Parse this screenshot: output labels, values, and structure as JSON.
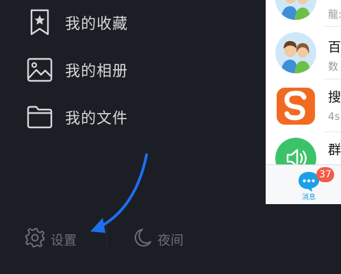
{
  "menu": {
    "items": [
      {
        "label": "我的收藏",
        "icon": "bookmark-star-icon"
      },
      {
        "label": "我的相册",
        "icon": "photo-album-icon"
      },
      {
        "label": "我的文件",
        "icon": "folder-icon"
      }
    ]
  },
  "bottom": {
    "settings_label": "设置",
    "settings_icon": "gear-icon",
    "night_label": "夜间",
    "night_icon": "moon-icon"
  },
  "annotation": {
    "arrow_color": "#1e6ff0",
    "arrow_icon": "curved-arrow-icon"
  },
  "chat_list": {
    "rows": [
      {
        "title": "",
        "subtitle": "龍:",
        "avatar": "couple-avatar-icon"
      },
      {
        "title": "百",
        "subtitle": "数",
        "avatar": "couple-avatar-icon"
      },
      {
        "title": "搜",
        "subtitle": "4s",
        "avatar": "sogou-logo-icon"
      },
      {
        "title": "群",
        "subtitle": "",
        "avatar": "speaker-icon"
      }
    ]
  },
  "tabbar": {
    "messages_label": "消息",
    "messages_badge": "37",
    "messages_icon": "chat-bubble-icon",
    "accent": "#1aa0e8",
    "badge_color": "#f25b48"
  }
}
